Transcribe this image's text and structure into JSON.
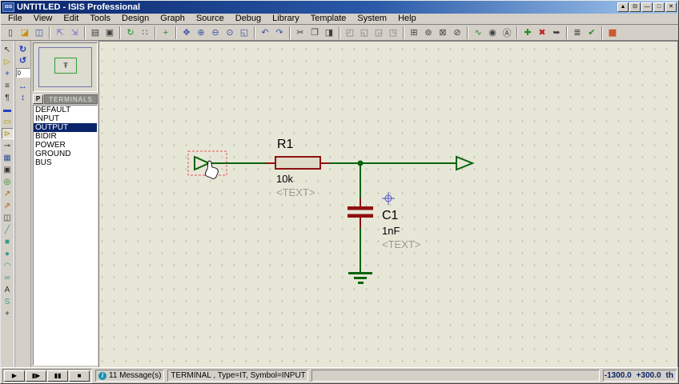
{
  "titlebar": {
    "app_icon": "ISIS",
    "title": "UNTITLED - ISIS Professional",
    "buttons": [
      {
        "name": "arrow-up-button",
        "glyph": "▲"
      },
      {
        "name": "rollup-button",
        "glyph": "⊟"
      },
      {
        "name": "minimize-button",
        "glyph": "—"
      },
      {
        "name": "maximize-button",
        "glyph": "□"
      },
      {
        "name": "close-button",
        "glyph": "✕"
      }
    ]
  },
  "menubar": {
    "items": [
      "File",
      "View",
      "Edit",
      "Tools",
      "Design",
      "Graph",
      "Source",
      "Debug",
      "Library",
      "Template",
      "System",
      "Help"
    ]
  },
  "toolbar": {
    "items": [
      {
        "name": "new-file",
        "glyph": "▯"
      },
      {
        "name": "open-folder",
        "glyph": "◪"
      },
      {
        "name": "save-file",
        "glyph": "◫"
      },
      {
        "name": "import-section",
        "glyph": "⇱"
      },
      {
        "name": "export-section",
        "glyph": "⇲"
      },
      {
        "name": "print",
        "glyph": "▤"
      },
      {
        "name": "mark-output-area",
        "glyph": "▣"
      },
      {
        "name": "redraw",
        "glyph": "↻"
      },
      {
        "name": "toggle-grid",
        "glyph": "∷"
      },
      {
        "name": "centre-at-origin",
        "glyph": "+"
      },
      {
        "name": "pan-view",
        "glyph": "✥"
      },
      {
        "name": "zoom-in",
        "glyph": "⊕"
      },
      {
        "name": "zoom-out",
        "glyph": "⊖"
      },
      {
        "name": "zoom-all",
        "glyph": "⊙"
      },
      {
        "name": "zoom-area",
        "glyph": "◱"
      },
      {
        "name": "undo",
        "glyph": "↶"
      },
      {
        "name": "redo",
        "glyph": "↷"
      },
      {
        "name": "cut",
        "glyph": "✂"
      },
      {
        "name": "copy",
        "glyph": "❐"
      },
      {
        "name": "paste",
        "glyph": "◨"
      },
      {
        "name": "block-copy",
        "glyph": "◰"
      },
      {
        "name": "block-move",
        "glyph": "◱"
      },
      {
        "name": "block-rotate",
        "glyph": "◲"
      },
      {
        "name": "block-delete",
        "glyph": "◳"
      },
      {
        "name": "pick-device",
        "glyph": "⊞"
      },
      {
        "name": "make-device",
        "glyph": "⊚"
      },
      {
        "name": "packaging-tool",
        "glyph": "⊠"
      },
      {
        "name": "decompose",
        "glyph": "⊘"
      },
      {
        "name": "wire-autorouter",
        "glyph": "∿"
      },
      {
        "name": "search-and-tag",
        "glyph": "◉"
      },
      {
        "name": "property-assignment",
        "glyph": "Ⓐ"
      },
      {
        "name": "new-sheet",
        "glyph": "✚"
      },
      {
        "name": "remove-sheet",
        "glyph": "✖"
      },
      {
        "name": "goto-sheet",
        "glyph": "➥"
      },
      {
        "name": "view-bom",
        "glyph": "≣"
      },
      {
        "name": "electrical-rules-check",
        "glyph": "✔"
      },
      {
        "name": "netlist-to-ares",
        "glyph": "▦"
      }
    ]
  },
  "sidebar": {
    "modes": [
      {
        "name": "selection-mode",
        "glyph": "↖"
      },
      {
        "name": "component-mode",
        "glyph": "▷"
      },
      {
        "name": "junction-dot-mode",
        "glyph": "+"
      },
      {
        "name": "wire-label-mode",
        "glyph": "≡"
      },
      {
        "name": "text-script-mode",
        "glyph": "¶"
      },
      {
        "name": "bus-mode",
        "glyph": "▬"
      },
      {
        "name": "subcircuit-mode",
        "glyph": "▭"
      },
      {
        "name": "terminal-mode",
        "glyph": "⊳"
      },
      {
        "name": "device-pin-mode",
        "glyph": "⊸"
      },
      {
        "name": "graph-mode",
        "glyph": "▦"
      },
      {
        "name": "tape-recorder-mode",
        "glyph": "▣"
      },
      {
        "name": "generator-mode",
        "glyph": "◎"
      },
      {
        "name": "voltage-probe-mode",
        "glyph": "↗"
      },
      {
        "name": "current-probe-mode",
        "glyph": "⇗"
      },
      {
        "name": "virtual-instrument-mode",
        "glyph": "◫"
      },
      {
        "name": "2d-line-mode",
        "glyph": "╱"
      },
      {
        "name": "2d-box-mode",
        "glyph": "■"
      },
      {
        "name": "2d-circle-mode",
        "glyph": "●"
      },
      {
        "name": "2d-arc-mode",
        "glyph": "◠"
      },
      {
        "name": "2d-path-mode",
        "glyph": "∞"
      },
      {
        "name": "2d-text-mode",
        "glyph": "A"
      },
      {
        "name": "2d-symbol-mode",
        "glyph": "S"
      },
      {
        "name": "2d-marker-mode",
        "glyph": "+"
      }
    ],
    "orientation": {
      "rotate_cw": "↻",
      "rotate_ccw": "↺",
      "angle": "0",
      "mirror_h": "↔",
      "mirror_v": "↕"
    }
  },
  "object_selector": {
    "pick_button": "P",
    "panel_title": "TERMINALS",
    "items": [
      "DEFAULT",
      "INPUT",
      "OUTPUT",
      "BIDIR",
      "POWER",
      "GROUND",
      "BUS"
    ],
    "selected_item": "OUTPUT",
    "preview_glyph": "Ŧ"
  },
  "schematic": {
    "r1_ref": "R1",
    "r1_value": "10k",
    "r1_text": "<TEXT>",
    "c1_ref": "C1",
    "c1_value": "1nF",
    "c1_text": "<TEXT>",
    "colors": {
      "wire_green": "#0a640a",
      "component_red": "#8f1010",
      "canvas_bg": "#e7e7d8",
      "selection_dash": "#e05858",
      "placeholder_gray": "#9a9a92",
      "highlight_navy": "#0a246a"
    }
  },
  "statusbar": {
    "playback": [
      {
        "name": "play-button",
        "glyph": "▶"
      },
      {
        "name": "step-button",
        "glyph": "▮▶"
      },
      {
        "name": "pause-button",
        "glyph": "▮▮"
      },
      {
        "name": "stop-button",
        "glyph": "■"
      }
    ],
    "message_count": "11 Message(s)",
    "info_icon": "i",
    "selection_info": "TERMINAL , Type=IT, Symbol=INPUT",
    "coord_x": "-1300.0",
    "coord_y": "+300.0",
    "coord_units": "th"
  }
}
